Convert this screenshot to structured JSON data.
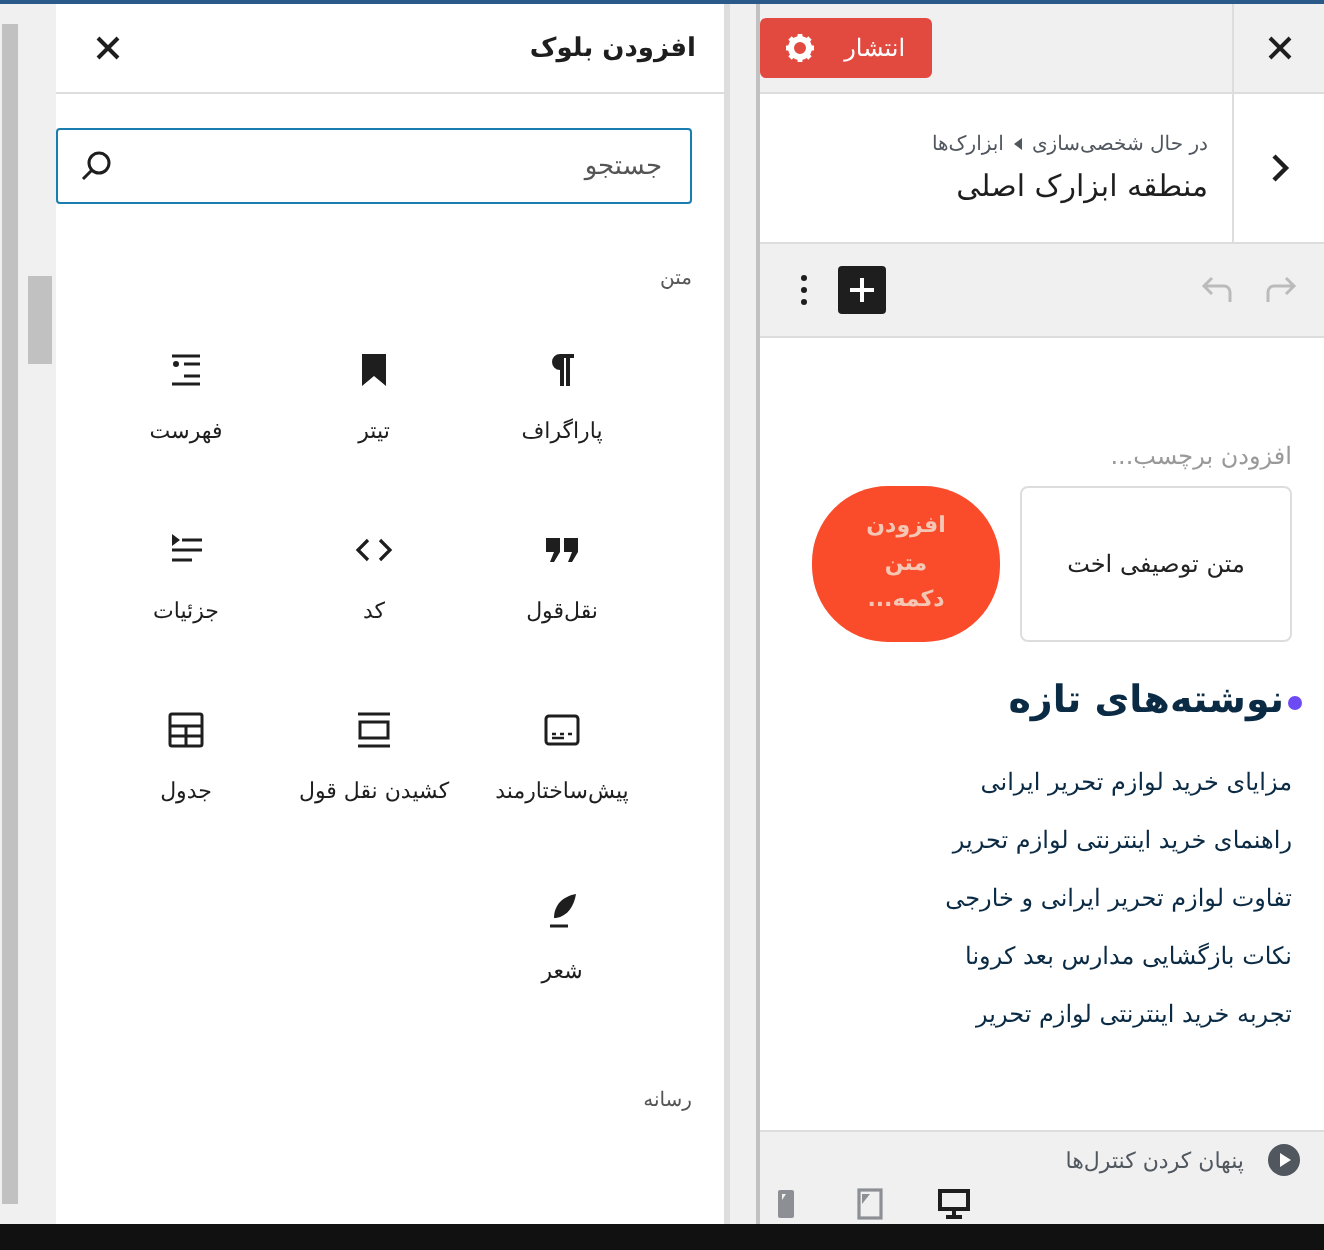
{
  "inserter": {
    "title": "افزودن بلوک",
    "search": {
      "placeholder": "جستجو"
    },
    "categories": [
      {
        "label": "متن",
        "blocks": [
          {
            "label": "پاراگراف",
            "kind": "paragraph"
          },
          {
            "label": "تیتر",
            "kind": "heading"
          },
          {
            "label": "فهرست",
            "kind": "list"
          },
          {
            "label": "نقل‌قول",
            "kind": "quote"
          },
          {
            "label": "کد",
            "kind": "code"
          },
          {
            "label": "جزئیات",
            "kind": "details"
          },
          {
            "label": "پیش‌ساختارمند",
            "kind": "preformatted"
          },
          {
            "label": "کشیدن نقل قول",
            "kind": "pullquote"
          },
          {
            "label": "جدول",
            "kind": "table"
          },
          {
            "label": "شعر",
            "kind": "verse"
          }
        ]
      },
      {
        "label": "رسانه"
      }
    ]
  },
  "customizer": {
    "publish_button": "انتشار",
    "breadcrumb": {
      "parent": "در حال شخصی‌سازی",
      "child": "ابزارک‌ها"
    },
    "section_title": "منطقه ابزارک اصلی",
    "preview": {
      "tag_placeholder": "افزودن برچسب...",
      "card_text": "متن توصیفی اخت",
      "button_text": "افزودن متن دکمه...",
      "heading": "نوشته‌های تازه",
      "posts": [
        "مزایای خرید لوازم تحریر ایرانی",
        "راهنمای خرید اینترنتی لوازم تحریر",
        "تفاوت لوازم تحریر ایرانی و خارجی",
        "نکات بازگشایی مدارس بعد کرونا",
        "تجربه خرید اینترنتی لوازم تحریر"
      ]
    },
    "hide_controls": "پنهان کردن کنترل‌ها",
    "devices": [
      {
        "kind": "desktop",
        "selected": true
      },
      {
        "kind": "tablet",
        "selected": false
      },
      {
        "kind": "mobile",
        "selected": false
      }
    ]
  }
}
